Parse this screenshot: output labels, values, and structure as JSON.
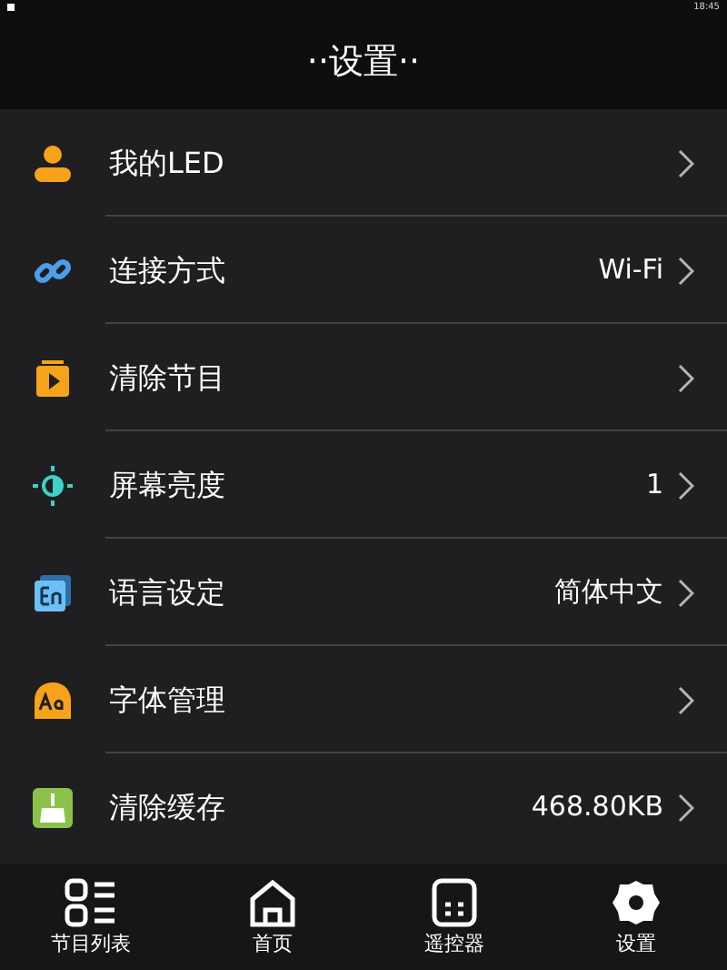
{
  "status_bar": {
    "time": "18:45"
  },
  "header": {
    "title": "··设置··"
  },
  "settings": [
    {
      "label": "我的LED"
    },
    {
      "label": "连接方式",
      "value": "Wi-Fi"
    },
    {
      "label": "清除节目"
    },
    {
      "label": "屏幕亮度",
      "value": "1"
    },
    {
      "label": "语言设定",
      "value": "简体中文"
    },
    {
      "label": "字体管理"
    },
    {
      "label": "清除缓存",
      "value": "468.80KB"
    }
  ],
  "bottom_nav": [
    {
      "label": "节目列表"
    },
    {
      "label": "首页"
    },
    {
      "label": "遥控器"
    },
    {
      "label": "设置"
    }
  ]
}
